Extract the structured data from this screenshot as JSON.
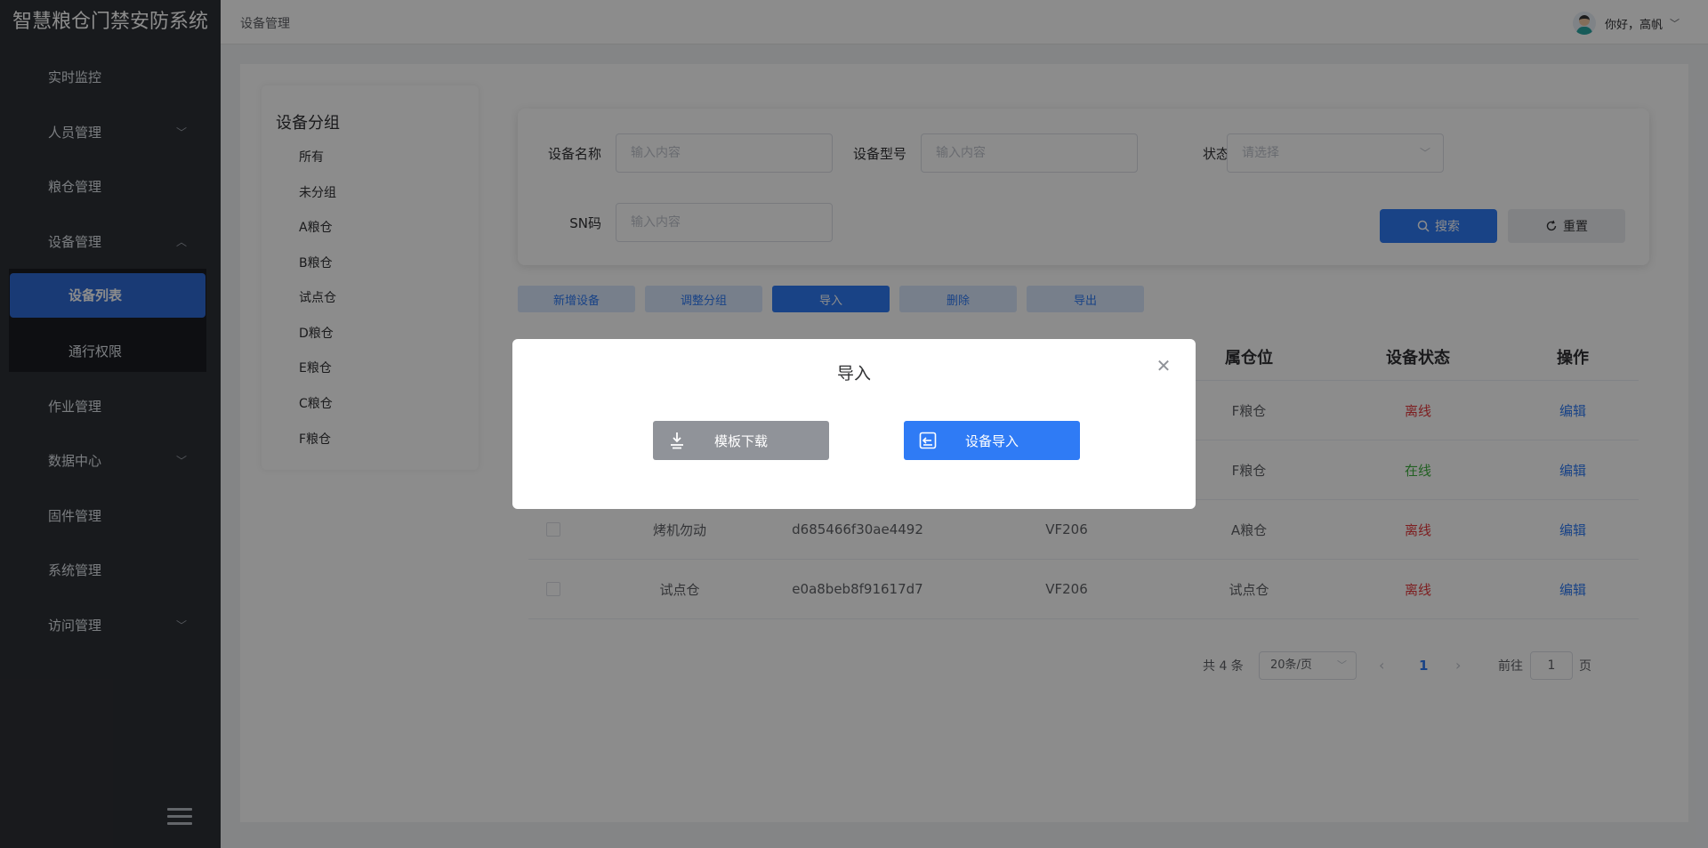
{
  "app": {
    "title": "智慧粮仓门禁安防系统"
  },
  "sidebar": {
    "items": [
      {
        "label": "实时监控",
        "expandable": false
      },
      {
        "label": "人员管理",
        "expandable": true
      },
      {
        "label": "粮仓管理",
        "expandable": false
      },
      {
        "label": "设备管理",
        "expandable": true,
        "expanded": true
      },
      {
        "label": "作业管理",
        "expandable": false
      },
      {
        "label": "数据中心",
        "expandable": true
      },
      {
        "label": "固件管理",
        "expandable": false
      },
      {
        "label": "系统管理",
        "expandable": false
      },
      {
        "label": "访问管理",
        "expandable": true
      }
    ],
    "sub_items": [
      {
        "label": "设备列表",
        "active": true
      },
      {
        "label": "通行权限",
        "active": false
      }
    ]
  },
  "header": {
    "breadcrumb": "设备管理",
    "user_greeting": "你好，高帆"
  },
  "groups": {
    "title": "设备分组",
    "items": [
      "所有",
      "未分组",
      "A粮仓",
      "B粮仓",
      "试点仓",
      "D粮仓",
      "E粮仓",
      "C粮仓",
      "F粮仓"
    ]
  },
  "search": {
    "name_label": "设备名称",
    "name_placeholder": "输入内容",
    "model_label": "设备型号",
    "model_placeholder": "输入内容",
    "status_label": "状态",
    "status_placeholder": "请选择",
    "sn_label": "SN码",
    "sn_placeholder": "输入内容",
    "search_button": "搜索",
    "reset_button": "重置"
  },
  "toolbar": {
    "add": "新增设备",
    "adjust_group": "调整分组",
    "import": "导入",
    "delete": "删除",
    "export": "导出"
  },
  "table": {
    "headers": [
      "属仓位",
      "设备状态",
      "操作"
    ],
    "rows": [
      {
        "name": "",
        "sn": "",
        "model": "",
        "location": "F粮仓",
        "status": "离线",
        "action": "编辑"
      },
      {
        "name": "",
        "sn": "",
        "model": "",
        "location": "F粮仓",
        "status": "在线",
        "action": "编辑"
      },
      {
        "name": "烤机勿动",
        "sn": "d685466f30ae4492",
        "model": "VF206",
        "location": "A粮仓",
        "status": "离线",
        "action": "编辑"
      },
      {
        "name": "试点仓",
        "sn": "e0a8beb8f91617d7",
        "model": "VF206",
        "location": "试点仓",
        "status": "离线",
        "action": "编辑"
      }
    ]
  },
  "pagination": {
    "total": "共 4 条",
    "page_size": "20条/页",
    "current_page": "1",
    "goto_label": "前往",
    "goto_value": "1",
    "page_suffix": "页"
  },
  "modal": {
    "title": "导入",
    "download_button": "模板下载",
    "import_button": "设备导入"
  },
  "colors": {
    "primary": "#2f7bf5",
    "sidebar_bg": "#2d3035",
    "offline": "#e4393c",
    "online": "#3eaf3e"
  }
}
